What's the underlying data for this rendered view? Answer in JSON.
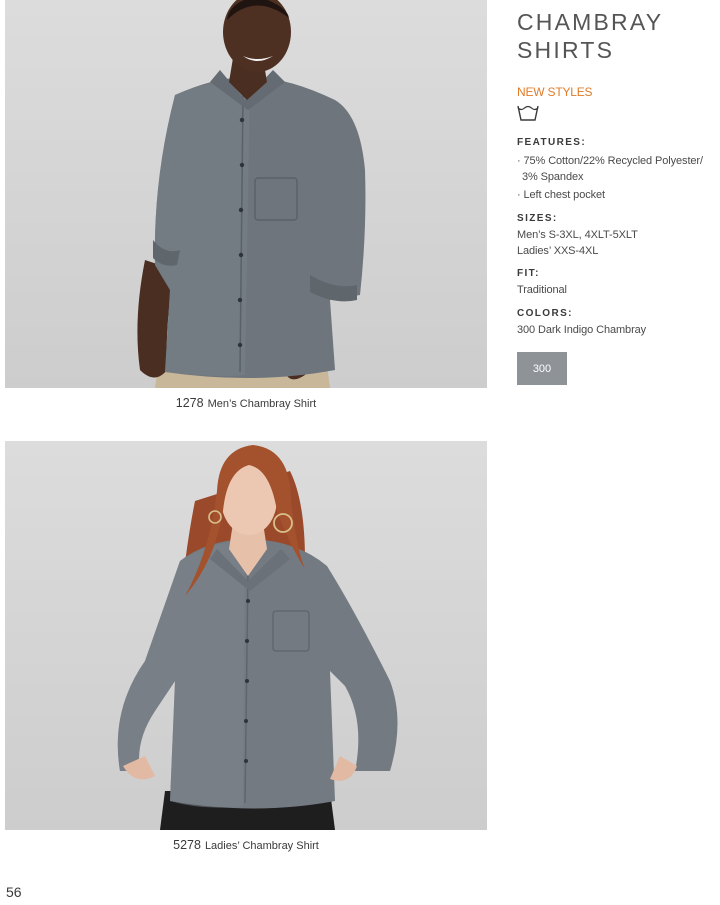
{
  "header": {
    "title_line1": "CHAMBRAY",
    "title_line2": "SHIRTS",
    "new_styles": "NEW STYLES",
    "care_icon": "wash-tub-icon"
  },
  "features": {
    "label": "FEATURES:",
    "items": [
      "· 75% Cotton/22% Recycled Polyester/",
      "3% Spandex",
      "· Left chest pocket"
    ]
  },
  "sizes": {
    "label": "SIZES:",
    "lines": [
      "Men’s S-3XL, 4XLT-5XLT",
      "Ladies’ XXS-4XL"
    ]
  },
  "fit": {
    "label": "FIT:",
    "value": "Traditional"
  },
  "colors": {
    "label": "COLORS:",
    "value": "300 Dark Indigo Chambray",
    "swatch_code": "300",
    "swatch_color": "#8e9398"
  },
  "products": [
    {
      "number": "1278",
      "name": "Men’s Chambray Shirt"
    },
    {
      "number": "5278",
      "name": "Ladies’ Chambray Shirt"
    }
  ],
  "page_number": "56",
  "accent_color": "#e07b2a"
}
